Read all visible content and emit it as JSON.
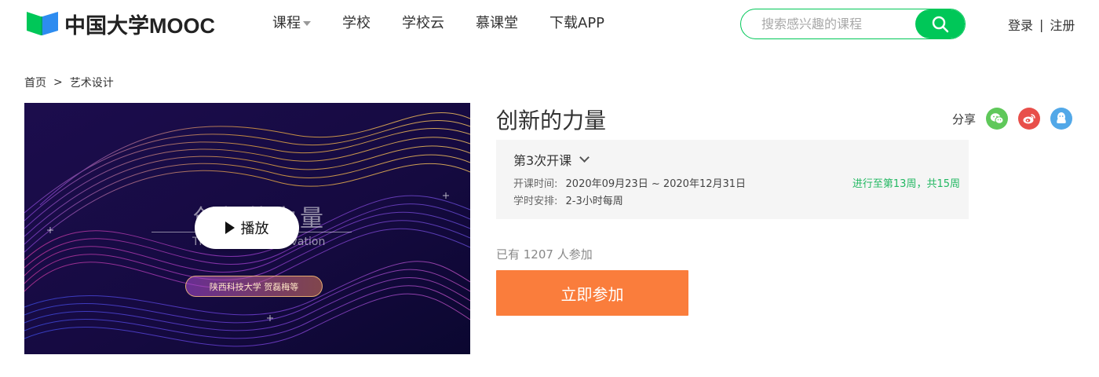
{
  "header": {
    "logo_text": "中国大学MOOC",
    "nav": [
      {
        "label": "课程",
        "has_dropdown": true
      },
      {
        "label": "学校",
        "has_dropdown": false
      },
      {
        "label": "学校云",
        "has_dropdown": false
      },
      {
        "label": "慕课堂",
        "has_dropdown": false
      },
      {
        "label": "下载APP",
        "has_dropdown": false
      }
    ],
    "search": {
      "placeholder": "搜索感兴趣的课程",
      "value": "",
      "icon": "search-icon"
    },
    "auth": {
      "login": "登录",
      "separator": "|",
      "register": "注册"
    }
  },
  "breadcrumb": {
    "home": "首页",
    "separator": ">",
    "category": "艺术设计"
  },
  "video": {
    "play_label": "播放",
    "overlay_title": "创新的力量",
    "overlay_subtitle": "The Power of Innovation",
    "overlay_badge": "陕西科技大学 贺磊梅等"
  },
  "course": {
    "title": "创新的力量",
    "share_label": "分享",
    "share_icons": [
      "wechat-icon",
      "weibo-icon",
      "qq-icon"
    ],
    "term": {
      "selected": "第3次开课",
      "time_label": "开课时间:",
      "time_value": "2020年09月23日 ~ 2020年12月31日",
      "schedule_label": "学时安排:",
      "schedule_value": "2-3小时每周",
      "progress": "进行至第13周，共15周"
    },
    "enroll_count": "已有 1207 人参加",
    "enroll_button": "立即参加"
  },
  "colors": {
    "brand_green": "#00c758",
    "progress_green": "#22b862",
    "enroll_orange": "#fa7d3c",
    "wechat": "#5fc85a",
    "weibo": "#e84f4a",
    "qq": "#52a8e8"
  }
}
